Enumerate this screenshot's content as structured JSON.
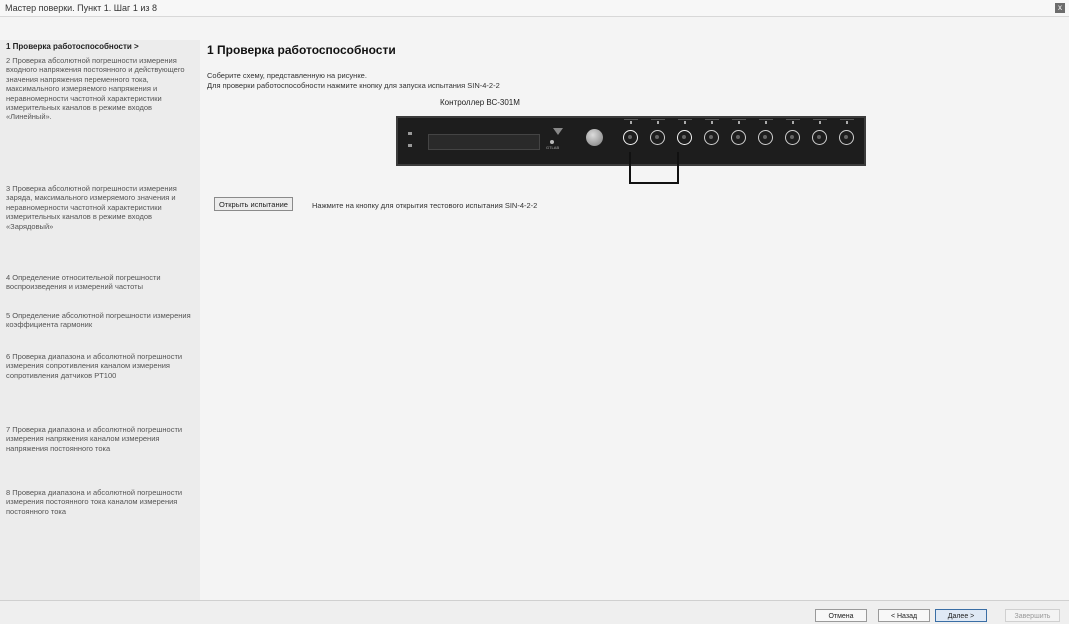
{
  "window": {
    "title": "Мастер поверки. Пункт 1. Шаг 1 из 8",
    "close_label": "x"
  },
  "sidebar": {
    "steps": [
      "1 Проверка работоспособности >",
      "2 Проверка абсолютной погрешности измерения входного напряжения постоянного и действующего значения напряжения переменного тока, максимального измеряемого напряжения и неравномерности частотной характеристики измерительных каналов в режиме входов «Линейный».",
      "3 Проверка абсолютной погрешности измерения заряда, максимального измеряемого значения и неравномерности частотной характеристики измерительных каналов в режиме входов «Зарядовый»",
      "4 Определение относительной погрешности воспроизведения и измерений частоты",
      "5 Определение абсолютной погрешности измерения коэффициента гармоник",
      "6 Проверка диапазона и абсолютной погрешности измерения сопротивления каналом измерения сопротивления датчиков PT100",
      "7 Проверка диапазона и абсолютной погрешности измерения напряжения каналом измерения напряжения постоянного тока",
      "8 Проверка диапазона и абсолютной погрешности измерения постоянного тока каналом измерения постоянного тока"
    ]
  },
  "main": {
    "heading": "1 Проверка работоспособности",
    "desc1": "Соберите схему, представленную на рисунке.",
    "desc2": "Для проверки работоспособности нажмите кнопку для запуска испытания SIN-4-2-2",
    "device_caption": "Контроллер ВС-301М",
    "device_logo": "GTLAB",
    "open_button": "Открыть испытание",
    "open_hint": "Нажмите на кнопку для открытия тестового испытания SIN-4-2-2"
  },
  "footer": {
    "cancel": "Отмена",
    "back": "< Назад",
    "next": "Далее >",
    "finish": "Завершить"
  }
}
